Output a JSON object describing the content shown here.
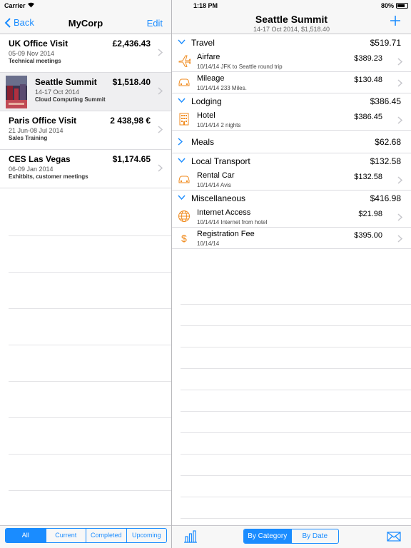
{
  "status_bar": {
    "carrier": "Carrier",
    "time": "1:18 PM",
    "battery": "80%",
    "battery_level": 0.8
  },
  "left_nav": {
    "back": "Back",
    "title": "MyCorp",
    "edit": "Edit"
  },
  "trips": [
    {
      "name": "UK Office Visit",
      "amount": "£2,436.43",
      "dates": "05-09 Nov 2014",
      "sub": "Technical meetings"
    },
    {
      "name": "Seattle Summit",
      "amount": "$1,518.40",
      "dates": "14-17 Oct 2014",
      "sub": "Cloud Computing Summit"
    },
    {
      "name": "Paris Office Visit",
      "amount": "2 438,98 €",
      "dates": "21 Jun-08 Jul 2014",
      "sub": "Sales Training"
    },
    {
      "name": "CES Las Vegas",
      "amount": "$1,174.65",
      "dates": "06-09 Jan 2014",
      "sub": "Exhitbits, customer meetings"
    }
  ],
  "filter_segments": [
    "All",
    "Current",
    "Completed",
    "Upcoming"
  ],
  "right_nav": {
    "title": "Seattle Summit",
    "subtitle": "14-17 Oct 2014, $1,518.40"
  },
  "categories": {
    "travel": {
      "name": "Travel",
      "total": "$519.71",
      "items": [
        {
          "name": "Airfare",
          "detail": "10/14/14 JFK to Seattle round trip",
          "amount": "$389.23"
        },
        {
          "name": "Mileage",
          "detail": "10/14/14 233 Miles.",
          "amount": "$130.48"
        }
      ]
    },
    "lodging": {
      "name": "Lodging",
      "total": "$386.45",
      "items": [
        {
          "name": "Hotel",
          "detail": "10/14/14 2 nights",
          "amount": "$386.45"
        }
      ]
    },
    "meals": {
      "name": "Meals",
      "total": "$62.68"
    },
    "local_transport": {
      "name": "Local Transport",
      "total": "$132.58",
      "items": [
        {
          "name": "Rental Car",
          "detail": "10/14/14 Avis",
          "amount": "$132.58"
        }
      ]
    },
    "misc": {
      "name": "Miscellaneous",
      "total": "$416.98",
      "items": [
        {
          "name": "Internet Access",
          "detail": "10/14/14 Internet from hotel",
          "amount": "$21.98"
        },
        {
          "name": "Registration Fee",
          "detail": "10/14/14",
          "amount": "$395.00"
        }
      ]
    }
  },
  "view_segments": [
    "By Category",
    "By Date"
  ],
  "colors": {
    "accent": "#1a8cff",
    "icon": "#f08a1c"
  }
}
